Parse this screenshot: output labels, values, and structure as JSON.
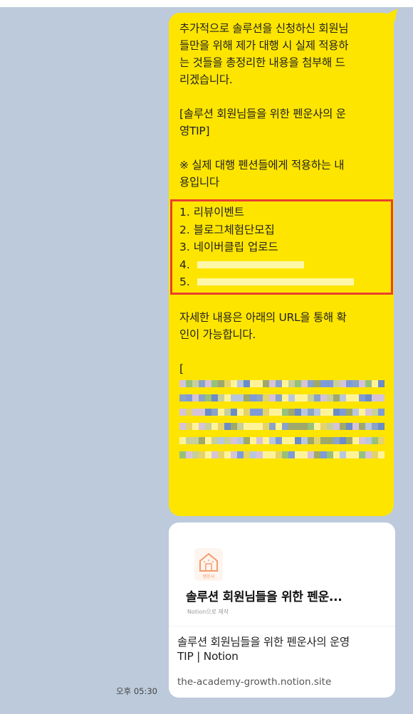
{
  "chat": {
    "intro": "추가적으로 솔루션을 신청하신 회원님\n들만을 위해 제가 대행 시 실제 적용하\n는 것들을 총정리한 내용을 첨부해 드\n리겠습니다.",
    "tip_title": "[솔루션 회원님들을 위한 펜운사의 운\n영TIP]",
    "note": "※ 실제 대행 펜션들에게 적용하는 내\n용입니다",
    "tips": [
      {
        "label": "1. 리뷰이벤트"
      },
      {
        "label": "2. 블로그체험단모집"
      },
      {
        "label": "3. 네이버클립 업로드"
      },
      {
        "label": "4."
      },
      {
        "label": "5."
      }
    ],
    "url_intro": "자세한 내용은 아래의 URL을 통해 확\n인이 가능합니다.",
    "bracket_open": "["
  },
  "link_card": {
    "logo_caption": "펜운사",
    "title": "솔루션 회원님들을 위한 펜운...",
    "made_with": "Notion으로 제작",
    "description": "솔루션 회원님들을 위한 펜운사의 운영\nTIP | Notion",
    "url": "the-academy-growth.notion.site"
  },
  "timestamp": "오후 05:30",
  "colors": {
    "background": "#bccadb",
    "bubble": "#fee500",
    "highlight_border": "#e8412c",
    "logo": "#f59a6b"
  }
}
